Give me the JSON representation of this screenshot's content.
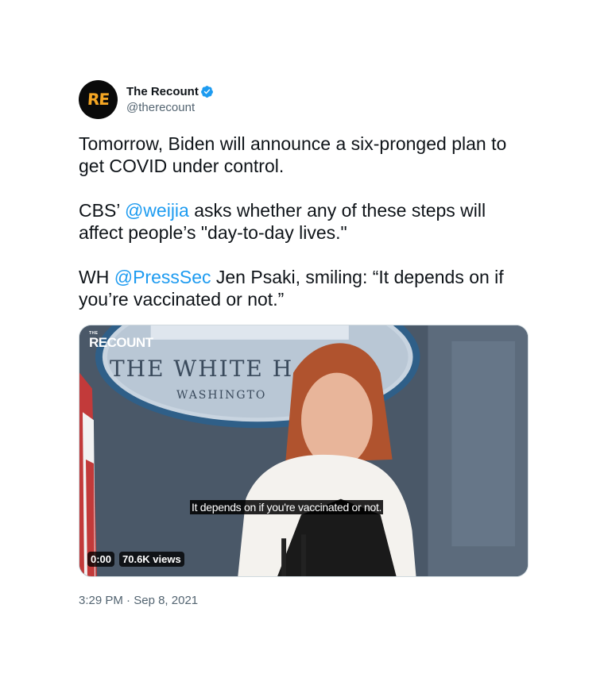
{
  "author": {
    "avatar_text": "RE",
    "display_name": "The Recount",
    "handle": "@therecount",
    "verified": true
  },
  "tweet": {
    "para1": "Tomorrow, Biden will announce a six-pronged plan to get COVID under control.",
    "para2_prefix": "CBS’ ",
    "para2_mention": "@weijia",
    "para2_suffix": " asks whether any of these steps will affect people’s \"day-to-day lives.\"",
    "para3_prefix": "WH ",
    "para3_mention": "@PressSec",
    "para3_suffix": " Jen Psaki, smiling: “It depends on if you’re vaccinated or not.”"
  },
  "media": {
    "brand_small": "THE",
    "brand_main": "RECOUNT",
    "seal_line1": "THE WHITE H",
    "seal_line2": "WASHINGTO",
    "caption": "It depends on if you're vaccinated or not.",
    "time": "0:00",
    "views": "70.6K views"
  },
  "meta": {
    "time": "3:29 PM",
    "separator": " · ",
    "date": "Sep 8, 2021"
  },
  "colors": {
    "link": "#1d9bf0",
    "text": "#0f1419",
    "secondary": "#536471",
    "brand_accent": "#f5a623"
  }
}
